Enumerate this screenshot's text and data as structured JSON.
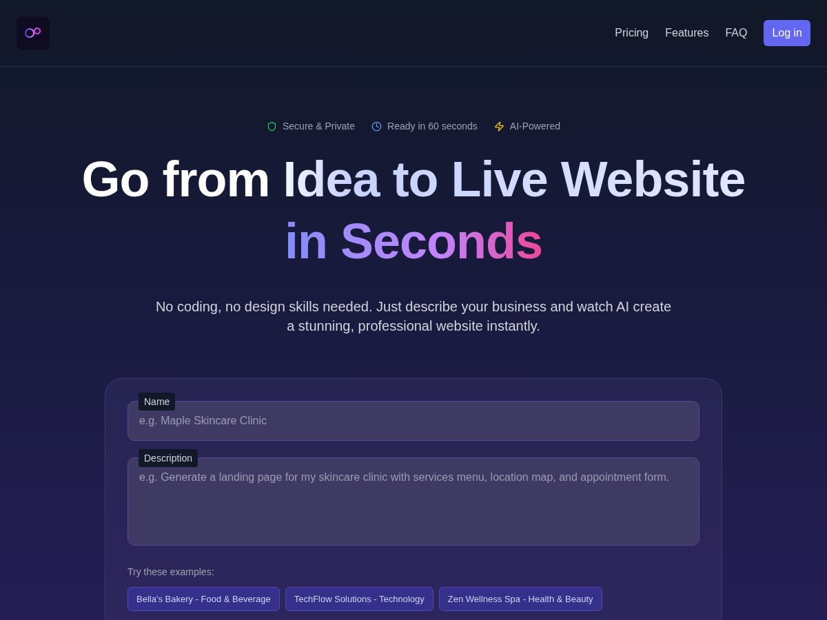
{
  "nav": {
    "links": [
      "Pricing",
      "Features",
      "FAQ"
    ],
    "login": "Log in"
  },
  "badges": [
    {
      "kind": "shield",
      "label": "Secure & Private"
    },
    {
      "kind": "clock",
      "label": "Ready in 60 seconds"
    },
    {
      "kind": "bolt",
      "label": "AI-Powered"
    }
  ],
  "headline": {
    "line_1": "Go from Idea to Live Website",
    "line_2": "in Seconds"
  },
  "subtitle": "No coding, no design skills needed. Just describe your business and watch AI create a stunning, professional website instantly.",
  "form": {
    "name": {
      "label": "Name",
      "placeholder": "e.g. Maple Skincare Clinic"
    },
    "description": {
      "label": "Description",
      "placeholder": "e.g. Generate a landing page for my skincare clinic with services menu, location map, and appointment form."
    },
    "examples_label": "Try these examples:",
    "examples": [
      "Bella's Bakery - Food & Beverage",
      "TechFlow Solutions - Technology",
      "Zen Wellness Spa - Health & Beauty"
    ]
  }
}
